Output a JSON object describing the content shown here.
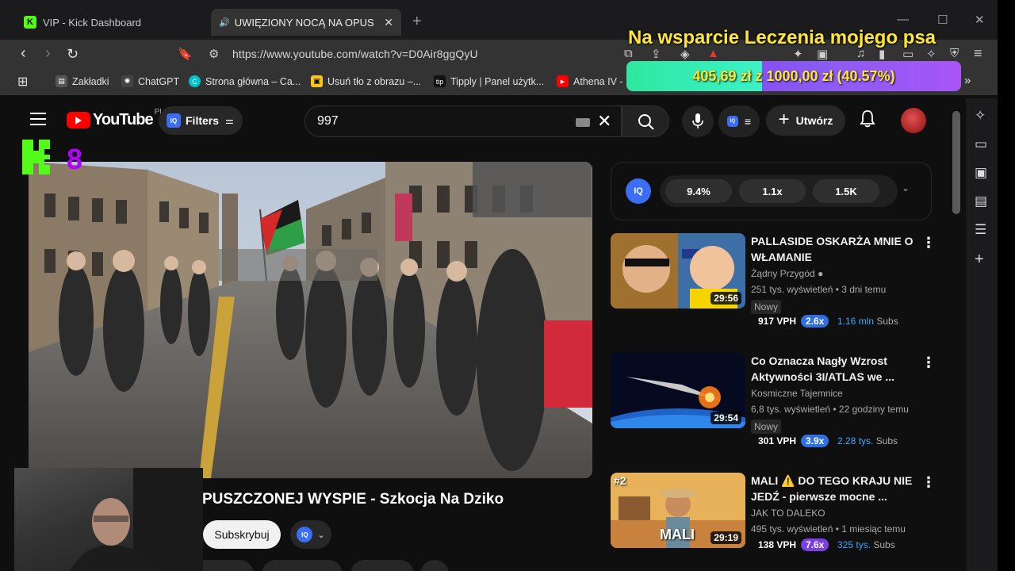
{
  "browser": {
    "tabs": [
      {
        "title": "VIP - Kick Dashboard",
        "icon": "kick-icon"
      },
      {
        "title": "UWIĘZIONY NOCĄ NA OPUS",
        "icon": "youtube-icon"
      }
    ],
    "url": "https://www.youtube.com/watch?v=D0Air8ggQyU",
    "bookmarks": [
      {
        "label": "Zakładki",
        "icon": "bookmark-folder-icon",
        "color": "#555555"
      },
      {
        "label": "ChatGPT",
        "icon": "chatgpt-icon",
        "color": "#444444"
      },
      {
        "label": "Strona główna – Ca...",
        "icon": "canva-icon",
        "color": "#00c4cc"
      },
      {
        "label": "Usuń tło z obrazu –...",
        "icon": "removebg-icon",
        "color": "#f5c518"
      },
      {
        "label": "Tipply | Panel użytk...",
        "icon": "tipply-icon",
        "color": "#111111"
      },
      {
        "label": "Athena IV -",
        "icon": "youtube-icon",
        "color": "#ff0000"
      }
    ]
  },
  "overlay": {
    "donation_title": "Na wsparcie Leczenia mojego psa",
    "goal_text": "405,69 zł z 1000,00 zł (40.57%)",
    "goal_fraction": 0.4057,
    "viewer_count": "8"
  },
  "youtube": {
    "logo_text": "YouTube",
    "country": "PL",
    "filters_label": "Filters",
    "search_value": "997",
    "create_label": "Utwórz",
    "video_title": "PUSZCZONEJ WYSPIE - Szkocja Na Dziko",
    "subscribe_label": "Subskrybuj",
    "iq_stats": [
      "9.4%",
      "1.1x",
      "1.5K"
    ],
    "recommendations": [
      {
        "title": "PALLASIDE OSKARŻA MNIE O WŁAMANIE",
        "channel": "Żądny Przygód",
        "meta": "251 tys. wyświetleń • 3 dni temu",
        "badge": "Nowy",
        "duration": "29:56",
        "vph": "917 VPH",
        "multiplier": "2.6x",
        "multiplier_color": "#2f6fe4",
        "subs": "1.16 mln",
        "subs_label": "Subs"
      },
      {
        "title": "Co Oznacza Nagły Wzrost Aktywności 3I/ATLAS we ...",
        "channel": "Kosmiczne Tajemnice",
        "meta": "6,8 tys. wyświetleń • 22 godziny temu",
        "badge": "Nowy",
        "duration": "29:54",
        "vph": "301 VPH",
        "multiplier": "3.9x",
        "multiplier_color": "#2f6fe4",
        "subs": "2.28 tys.",
        "subs_label": "Subs"
      },
      {
        "title": "MALI ⚠️ DO TEGO KRAJU NIE JEDŹ - pierwsze mocne ...",
        "channel": "JAK TO DALEKO",
        "meta": "495 tys. wyświetleń • 1 miesiąc temu",
        "badge": "",
        "duration": "29:19",
        "thumb_rank": "#2",
        "thumb_label": "MALI",
        "vph": "138 VPH",
        "multiplier": "7.6x",
        "multiplier_color": "#7b3fe4",
        "subs": "325 tys.",
        "subs_label": "Subs"
      }
    ]
  }
}
